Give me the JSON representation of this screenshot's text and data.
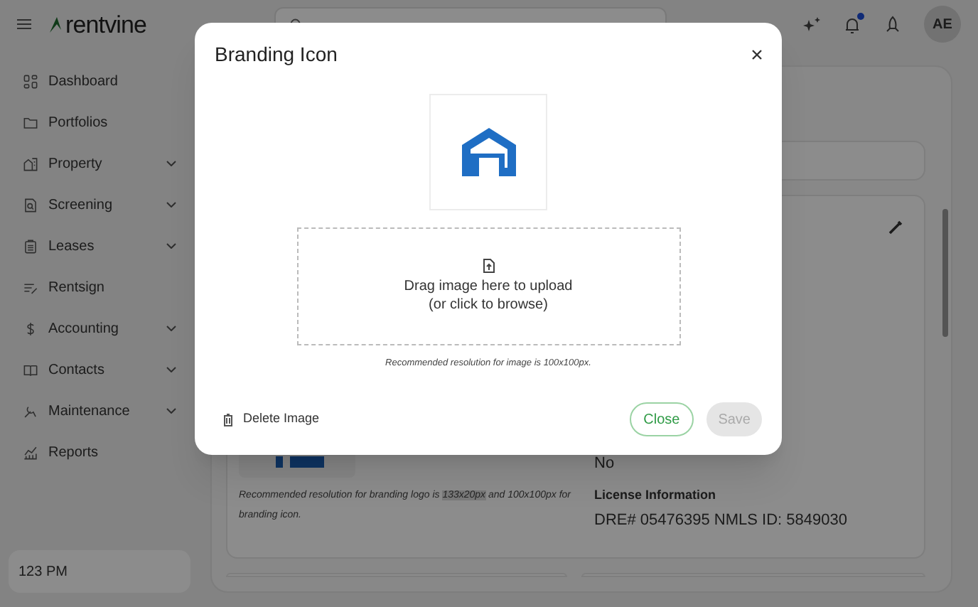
{
  "header": {
    "logo": "rentvine",
    "notification_unread": true,
    "avatar": "AE"
  },
  "sidebar": {
    "items": [
      {
        "label": "Dashboard",
        "expandable": false
      },
      {
        "label": "Portfolios",
        "expandable": false
      },
      {
        "label": "Property",
        "expandable": true
      },
      {
        "label": "Screening",
        "expandable": true
      },
      {
        "label": "Leases",
        "expandable": true
      },
      {
        "label": "Rentsign",
        "expandable": false
      },
      {
        "label": "Accounting",
        "expandable": true
      },
      {
        "label": "Contacts",
        "expandable": true
      },
      {
        "label": "Maintenance",
        "expandable": true
      },
      {
        "label": "Reports",
        "expandable": false
      }
    ],
    "footer": "123 PM"
  },
  "content": {
    "logo_note": {
      "before": "Recommended resolution for branding logo is",
      "highlight": "133x20px",
      "after": "and 100x100px for branding icon."
    },
    "details": [
      {
        "value": "No"
      },
      {
        "label": "License Information",
        "value": "DRE# 05476395 NMLS ID: 5849030"
      }
    ]
  },
  "modal": {
    "title": "Branding Icon",
    "drop_text": [
      "Drag image here to upload",
      "(or click to browse)"
    ],
    "hint": "Recommended resolution for image is 100x100px.",
    "delete": "Delete Image",
    "buttons": [
      {
        "label": "Close",
        "kind": "secondary",
        "disabled": false
      },
      {
        "label": "Save",
        "kind": "primary",
        "disabled": true
      }
    ]
  }
}
